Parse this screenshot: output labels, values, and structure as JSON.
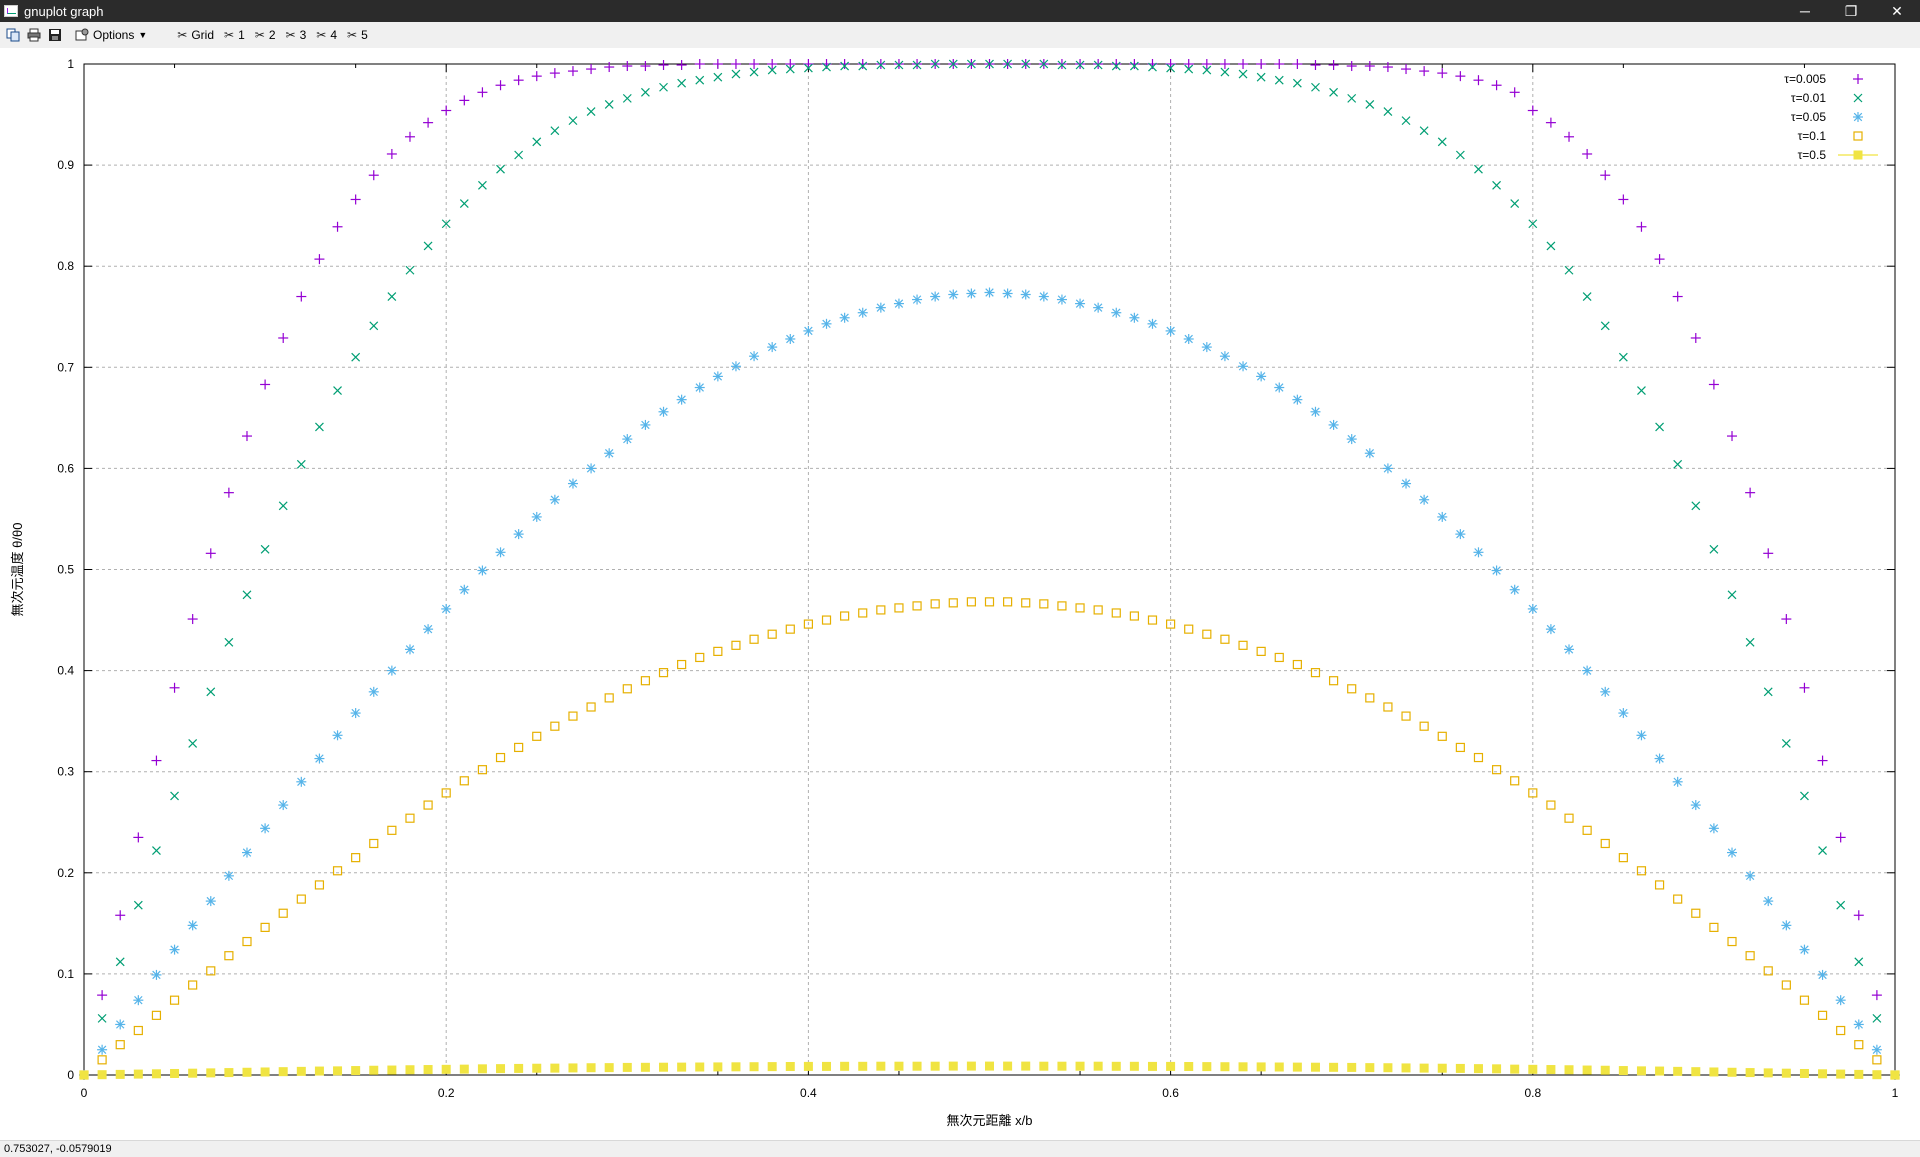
{
  "window": {
    "title": "gnuplot graph",
    "controls": {
      "minimize": "─",
      "restore": "❐",
      "close": "✕"
    }
  },
  "toolbar": {
    "copy_icon": "copy-icon",
    "print_icon": "print-icon",
    "save_icon": "save-icon",
    "options_label": "Options",
    "grid_label": "Grid",
    "plot_toggles": [
      "1",
      "2",
      "3",
      "4",
      "5"
    ]
  },
  "status": {
    "coords": "0.753027, -0.0579019"
  },
  "chart_data": {
    "type": "scatter",
    "title": "",
    "xlabel": "無次元距離 x/b",
    "ylabel": "無次元温度 θ/θ0",
    "xlim": [
      0,
      1
    ],
    "ylim": [
      0,
      1
    ],
    "grid": true,
    "legend_position": "top-right",
    "x_ticks": [
      "0",
      "0.2",
      "0.4",
      "0.6",
      "0.8",
      "1"
    ],
    "y_ticks": [
      "0",
      "0.1",
      "0.2",
      "0.3",
      "0.4",
      "0.5",
      "0.6",
      "0.7",
      "0.8",
      "0.9",
      "1"
    ],
    "x": [
      0,
      0.01,
      0.02,
      0.03,
      0.04,
      0.05,
      0.06,
      0.07,
      0.08,
      0.09,
      0.1,
      0.11,
      0.12,
      0.13,
      0.14,
      0.15,
      0.16,
      0.17,
      0.18,
      0.19,
      0.2,
      0.21,
      0.22,
      0.23,
      0.24,
      0.25,
      0.26,
      0.27,
      0.28,
      0.29,
      0.3,
      0.31,
      0.32,
      0.33,
      0.34,
      0.35,
      0.36,
      0.37,
      0.38,
      0.39,
      0.4,
      0.41,
      0.42,
      0.43,
      0.44,
      0.45,
      0.46,
      0.47,
      0.48,
      0.49,
      0.5,
      0.51,
      0.52,
      0.53,
      0.54,
      0.55,
      0.56,
      0.57,
      0.58,
      0.59,
      0.6,
      0.61,
      0.62,
      0.63,
      0.64,
      0.65,
      0.66,
      0.67,
      0.68,
      0.69,
      0.7,
      0.71,
      0.72,
      0.73,
      0.74,
      0.75,
      0.76,
      0.77,
      0.78,
      0.79,
      0.8,
      0.81,
      0.82,
      0.83,
      0.84,
      0.85,
      0.86,
      0.87,
      0.88,
      0.89,
      0.9,
      0.91,
      0.92,
      0.93,
      0.94,
      0.95,
      0.96,
      0.97,
      0.98,
      0.99,
      1
    ],
    "series": [
      {
        "name": "τ=0.005",
        "marker": "plus",
        "color": "#9400d3",
        "values": [
          0,
          0.079,
          0.158,
          0.235,
          0.311,
          0.383,
          0.451,
          0.516,
          0.576,
          0.632,
          0.683,
          0.729,
          0.77,
          0.807,
          0.839,
          0.866,
          0.89,
          0.911,
          0.928,
          0.942,
          0.954,
          0.964,
          0.972,
          0.979,
          0.984,
          0.988,
          0.991,
          0.993,
          0.995,
          0.997,
          0.998,
          0.998,
          0.999,
          0.999,
          1,
          1,
          1,
          1,
          1,
          1,
          1,
          1,
          1,
          1,
          1,
          1,
          1,
          1,
          1,
          1,
          1,
          1,
          1,
          1,
          1,
          1,
          1,
          1,
          1,
          1,
          1,
          1,
          1,
          1,
          1,
          1,
          1,
          1,
          0.999,
          0.999,
          0.998,
          0.998,
          0.997,
          0.995,
          0.993,
          0.991,
          0.988,
          0.984,
          0.979,
          0.972,
          0.954,
          0.942,
          0.928,
          0.911,
          0.89,
          0.866,
          0.839,
          0.807,
          0.77,
          0.729,
          0.683,
          0.632,
          0.576,
          0.516,
          0.451,
          0.383,
          0.311,
          0.235,
          0.158,
          0.079,
          0
        ]
      },
      {
        "name": "τ=0.01",
        "marker": "cross",
        "color": "#009e73",
        "values": [
          0,
          0.056,
          0.112,
          0.168,
          0.222,
          0.276,
          0.328,
          0.379,
          0.428,
          0.475,
          0.52,
          0.563,
          0.604,
          0.641,
          0.677,
          0.71,
          0.741,
          0.77,
          0.796,
          0.82,
          0.842,
          0.862,
          0.88,
          0.896,
          0.91,
          0.923,
          0.934,
          0.944,
          0.953,
          0.96,
          0.966,
          0.972,
          0.977,
          0.981,
          0.984,
          0.987,
          0.99,
          0.992,
          0.994,
          0.995,
          0.996,
          0.997,
          0.998,
          0.998,
          0.999,
          0.999,
          0.999,
          1,
          1,
          1,
          1,
          1,
          1,
          1,
          0.999,
          0.999,
          0.999,
          0.998,
          0.998,
          0.997,
          0.996,
          0.995,
          0.994,
          0.992,
          0.99,
          0.987,
          0.984,
          0.981,
          0.977,
          0.972,
          0.966,
          0.96,
          0.953,
          0.944,
          0.934,
          0.923,
          0.91,
          0.896,
          0.88,
          0.862,
          0.842,
          0.82,
          0.796,
          0.77,
          0.741,
          0.71,
          0.677,
          0.641,
          0.604,
          0.563,
          0.52,
          0.475,
          0.428,
          0.379,
          0.328,
          0.276,
          0.222,
          0.168,
          0.112,
          0.056,
          0
        ]
      },
      {
        "name": "τ=0.05",
        "marker": "star",
        "color": "#56b4e9",
        "values": [
          0,
          0.025,
          0.05,
          0.074,
          0.099,
          0.124,
          0.148,
          0.172,
          0.197,
          0.22,
          0.244,
          0.267,
          0.29,
          0.313,
          0.336,
          0.358,
          0.379,
          0.4,
          0.421,
          0.441,
          0.461,
          0.48,
          0.499,
          0.517,
          0.535,
          0.552,
          0.569,
          0.585,
          0.6,
          0.615,
          0.629,
          0.643,
          0.656,
          0.668,
          0.68,
          0.691,
          0.701,
          0.711,
          0.72,
          0.728,
          0.736,
          0.743,
          0.749,
          0.754,
          0.759,
          0.763,
          0.767,
          0.77,
          0.772,
          0.773,
          0.774,
          0.773,
          0.772,
          0.77,
          0.767,
          0.763,
          0.759,
          0.754,
          0.749,
          0.743,
          0.736,
          0.728,
          0.72,
          0.711,
          0.701,
          0.691,
          0.68,
          0.668,
          0.656,
          0.643,
          0.629,
          0.615,
          0.6,
          0.585,
          0.569,
          0.552,
          0.535,
          0.517,
          0.499,
          0.48,
          0.461,
          0.441,
          0.421,
          0.4,
          0.379,
          0.358,
          0.336,
          0.313,
          0.29,
          0.267,
          0.244,
          0.22,
          0.197,
          0.172,
          0.148,
          0.124,
          0.099,
          0.074,
          0.05,
          0.025,
          0
        ]
      },
      {
        "name": "τ=0.1",
        "marker": "square",
        "color": "#e6b000",
        "values": [
          0,
          0.015,
          0.03,
          0.044,
          0.059,
          0.074,
          0.089,
          0.103,
          0.118,
          0.132,
          0.146,
          0.16,
          0.174,
          0.188,
          0.202,
          0.215,
          0.229,
          0.242,
          0.254,
          0.267,
          0.279,
          0.291,
          0.302,
          0.314,
          0.324,
          0.335,
          0.345,
          0.355,
          0.364,
          0.373,
          0.382,
          0.39,
          0.398,
          0.406,
          0.413,
          0.419,
          0.425,
          0.431,
          0.436,
          0.441,
          0.446,
          0.45,
          0.454,
          0.457,
          0.46,
          0.462,
          0.464,
          0.466,
          0.467,
          0.468,
          0.468,
          0.468,
          0.467,
          0.466,
          0.464,
          0.462,
          0.46,
          0.457,
          0.454,
          0.45,
          0.446,
          0.441,
          0.436,
          0.431,
          0.425,
          0.419,
          0.413,
          0.406,
          0.398,
          0.39,
          0.382,
          0.373,
          0.364,
          0.355,
          0.345,
          0.335,
          0.324,
          0.314,
          0.302,
          0.291,
          0.279,
          0.267,
          0.254,
          0.242,
          0.229,
          0.215,
          0.202,
          0.188,
          0.174,
          0.16,
          0.146,
          0.132,
          0.118,
          0.103,
          0.089,
          0.074,
          0.059,
          0.044,
          0.03,
          0.015,
          0
        ]
      },
      {
        "name": "τ=0.5",
        "marker": "square-filled-line",
        "color": "#f0e442",
        "values": [
          0,
          0.0003,
          0.0006,
          0.0009,
          0.0012,
          0.0015,
          0.0018,
          0.0021,
          0.0024,
          0.0027,
          0.003,
          0.0033,
          0.0036,
          0.0039,
          0.0041,
          0.0044,
          0.0047,
          0.0049,
          0.0052,
          0.0054,
          0.0056,
          0.0058,
          0.0061,
          0.0063,
          0.0065,
          0.0067,
          0.0068,
          0.007,
          0.0072,
          0.0073,
          0.0075,
          0.0076,
          0.0077,
          0.0078,
          0.0079,
          0.008,
          0.0081,
          0.0082,
          0.0083,
          0.0084,
          0.0085,
          0.0085,
          0.0086,
          0.0086,
          0.0087,
          0.0087,
          0.0087,
          0.0087,
          0.0088,
          0.0088,
          0.0088,
          0.0088,
          0.0088,
          0.0087,
          0.0087,
          0.0087,
          0.0087,
          0.0086,
          0.0086,
          0.0085,
          0.0085,
          0.0084,
          0.0083,
          0.0082,
          0.0081,
          0.008,
          0.0079,
          0.0078,
          0.0077,
          0.0076,
          0.0075,
          0.0073,
          0.0072,
          0.007,
          0.0068,
          0.0067,
          0.0065,
          0.0063,
          0.0061,
          0.0058,
          0.0056,
          0.0054,
          0.0052,
          0.0049,
          0.0047,
          0.0044,
          0.0041,
          0.0039,
          0.0036,
          0.0033,
          0.003,
          0.0027,
          0.0024,
          0.0021,
          0.0018,
          0.0015,
          0.0012,
          0.0009,
          0.0006,
          0.0003,
          0
        ]
      }
    ]
  }
}
